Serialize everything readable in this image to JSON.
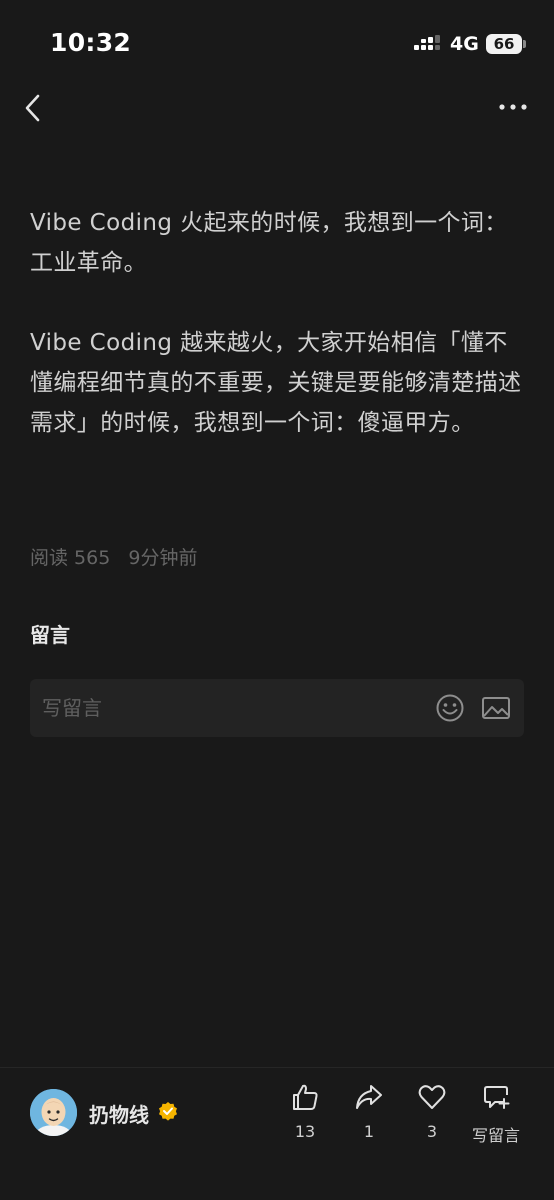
{
  "status_bar": {
    "time": "10:32",
    "network": "4G",
    "battery": "66"
  },
  "nav": {
    "back_icon": "chevron-left-icon",
    "more_icon": "more-horizontal-icon"
  },
  "article": {
    "paragraphs": [
      "Vibe Coding 火起来的时候，我想到一个词：工业革命。",
      "Vibe Coding 越来越火，大家开始相信「懂不懂编程细节真的不重要，关键是要能够清楚描述需求」的时候，我想到一个词：傻逼甲方。"
    ],
    "reads": "阅读 565",
    "time_ago": "9分钟前"
  },
  "comments": {
    "title": "留言",
    "placeholder": "写留言"
  },
  "bottom_bar": {
    "author_name": "扔物线",
    "like_count": "13",
    "share_count": "1",
    "favorite_count": "3",
    "write_comment_label": "写留言"
  },
  "colors": {
    "background": "#191919",
    "text": "#d0d0d0",
    "muted": "#666666",
    "verified_badge": "#f5b400",
    "avatar_bg": "#6fb6e0"
  }
}
